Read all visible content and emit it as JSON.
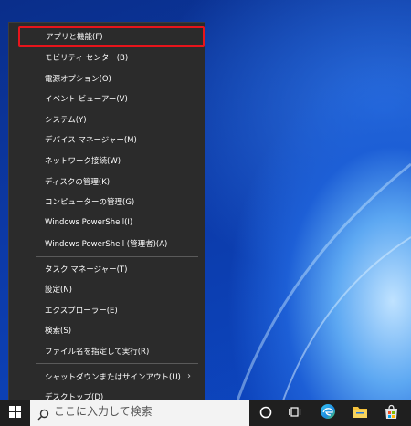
{
  "menu": {
    "items": [
      {
        "label": "アプリと機能(F)"
      },
      {
        "label": "モビリティ センター(B)"
      },
      {
        "label": "電源オプション(O)"
      },
      {
        "label": "イベント ビューアー(V)"
      },
      {
        "label": "システム(Y)"
      },
      {
        "label": "デバイス マネージャー(M)"
      },
      {
        "label": "ネットワーク接続(W)"
      },
      {
        "label": "ディスクの管理(K)"
      },
      {
        "label": "コンピューターの管理(G)"
      },
      {
        "label": "Windows PowerShell(I)"
      },
      {
        "label": "Windows PowerShell (管理者)(A)"
      },
      {
        "label": "タスク マネージャー(T)"
      },
      {
        "label": "設定(N)"
      },
      {
        "label": "エクスプローラー(E)"
      },
      {
        "label": "検索(S)"
      },
      {
        "label": "ファイル名を指定して実行(R)"
      },
      {
        "label": "シャットダウンまたはサインアウト(U)"
      },
      {
        "label": "デスクトップ(D)"
      }
    ],
    "highlight_color": "#e8141b"
  },
  "taskbar": {
    "search_placeholder": "ここに入力して検索",
    "icons": [
      "windows-start-icon",
      "search-icon",
      "cortana-icon",
      "task-view-icon",
      "edge-icon",
      "file-explorer-icon",
      "store-icon"
    ]
  }
}
